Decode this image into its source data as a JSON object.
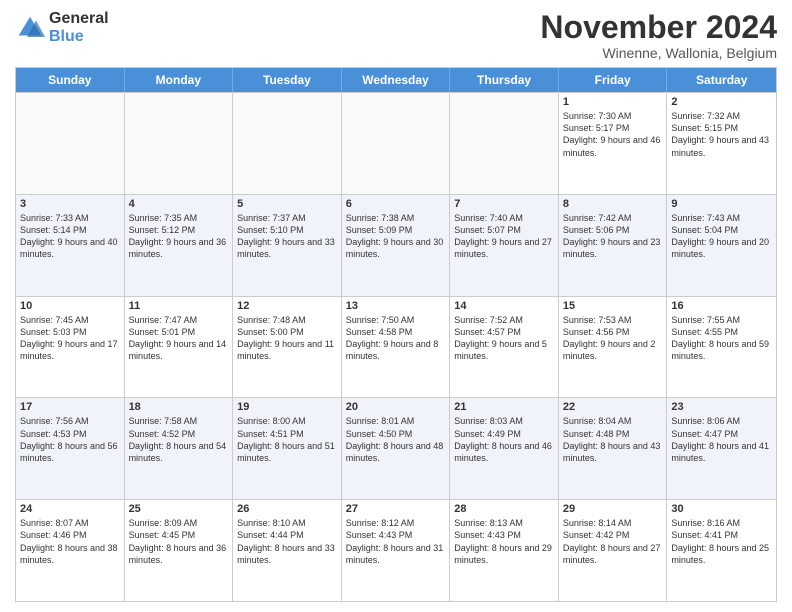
{
  "logo": {
    "general": "General",
    "blue": "Blue"
  },
  "header": {
    "month": "November 2024",
    "location": "Winenne, Wallonia, Belgium"
  },
  "weekdays": [
    "Sunday",
    "Monday",
    "Tuesday",
    "Wednesday",
    "Thursday",
    "Friday",
    "Saturday"
  ],
  "weeks": [
    [
      {
        "day": "",
        "info": ""
      },
      {
        "day": "",
        "info": ""
      },
      {
        "day": "",
        "info": ""
      },
      {
        "day": "",
        "info": ""
      },
      {
        "day": "",
        "info": ""
      },
      {
        "day": "1",
        "info": "Sunrise: 7:30 AM\nSunset: 5:17 PM\nDaylight: 9 hours and 46 minutes."
      },
      {
        "day": "2",
        "info": "Sunrise: 7:32 AM\nSunset: 5:15 PM\nDaylight: 9 hours and 43 minutes."
      }
    ],
    [
      {
        "day": "3",
        "info": "Sunrise: 7:33 AM\nSunset: 5:14 PM\nDaylight: 9 hours and 40 minutes."
      },
      {
        "day": "4",
        "info": "Sunrise: 7:35 AM\nSunset: 5:12 PM\nDaylight: 9 hours and 36 minutes."
      },
      {
        "day": "5",
        "info": "Sunrise: 7:37 AM\nSunset: 5:10 PM\nDaylight: 9 hours and 33 minutes."
      },
      {
        "day": "6",
        "info": "Sunrise: 7:38 AM\nSunset: 5:09 PM\nDaylight: 9 hours and 30 minutes."
      },
      {
        "day": "7",
        "info": "Sunrise: 7:40 AM\nSunset: 5:07 PM\nDaylight: 9 hours and 27 minutes."
      },
      {
        "day": "8",
        "info": "Sunrise: 7:42 AM\nSunset: 5:06 PM\nDaylight: 9 hours and 23 minutes."
      },
      {
        "day": "9",
        "info": "Sunrise: 7:43 AM\nSunset: 5:04 PM\nDaylight: 9 hours and 20 minutes."
      }
    ],
    [
      {
        "day": "10",
        "info": "Sunrise: 7:45 AM\nSunset: 5:03 PM\nDaylight: 9 hours and 17 minutes."
      },
      {
        "day": "11",
        "info": "Sunrise: 7:47 AM\nSunset: 5:01 PM\nDaylight: 9 hours and 14 minutes."
      },
      {
        "day": "12",
        "info": "Sunrise: 7:48 AM\nSunset: 5:00 PM\nDaylight: 9 hours and 11 minutes."
      },
      {
        "day": "13",
        "info": "Sunrise: 7:50 AM\nSunset: 4:58 PM\nDaylight: 9 hours and 8 minutes."
      },
      {
        "day": "14",
        "info": "Sunrise: 7:52 AM\nSunset: 4:57 PM\nDaylight: 9 hours and 5 minutes."
      },
      {
        "day": "15",
        "info": "Sunrise: 7:53 AM\nSunset: 4:56 PM\nDaylight: 9 hours and 2 minutes."
      },
      {
        "day": "16",
        "info": "Sunrise: 7:55 AM\nSunset: 4:55 PM\nDaylight: 8 hours and 59 minutes."
      }
    ],
    [
      {
        "day": "17",
        "info": "Sunrise: 7:56 AM\nSunset: 4:53 PM\nDaylight: 8 hours and 56 minutes."
      },
      {
        "day": "18",
        "info": "Sunrise: 7:58 AM\nSunset: 4:52 PM\nDaylight: 8 hours and 54 minutes."
      },
      {
        "day": "19",
        "info": "Sunrise: 8:00 AM\nSunset: 4:51 PM\nDaylight: 8 hours and 51 minutes."
      },
      {
        "day": "20",
        "info": "Sunrise: 8:01 AM\nSunset: 4:50 PM\nDaylight: 8 hours and 48 minutes."
      },
      {
        "day": "21",
        "info": "Sunrise: 8:03 AM\nSunset: 4:49 PM\nDaylight: 8 hours and 46 minutes."
      },
      {
        "day": "22",
        "info": "Sunrise: 8:04 AM\nSunset: 4:48 PM\nDaylight: 8 hours and 43 minutes."
      },
      {
        "day": "23",
        "info": "Sunrise: 8:06 AM\nSunset: 4:47 PM\nDaylight: 8 hours and 41 minutes."
      }
    ],
    [
      {
        "day": "24",
        "info": "Sunrise: 8:07 AM\nSunset: 4:46 PM\nDaylight: 8 hours and 38 minutes."
      },
      {
        "day": "25",
        "info": "Sunrise: 8:09 AM\nSunset: 4:45 PM\nDaylight: 8 hours and 36 minutes."
      },
      {
        "day": "26",
        "info": "Sunrise: 8:10 AM\nSunset: 4:44 PM\nDaylight: 8 hours and 33 minutes."
      },
      {
        "day": "27",
        "info": "Sunrise: 8:12 AM\nSunset: 4:43 PM\nDaylight: 8 hours and 31 minutes."
      },
      {
        "day": "28",
        "info": "Sunrise: 8:13 AM\nSunset: 4:43 PM\nDaylight: 8 hours and 29 minutes."
      },
      {
        "day": "29",
        "info": "Sunrise: 8:14 AM\nSunset: 4:42 PM\nDaylight: 8 hours and 27 minutes."
      },
      {
        "day": "30",
        "info": "Sunrise: 8:16 AM\nSunset: 4:41 PM\nDaylight: 8 hours and 25 minutes."
      }
    ]
  ]
}
